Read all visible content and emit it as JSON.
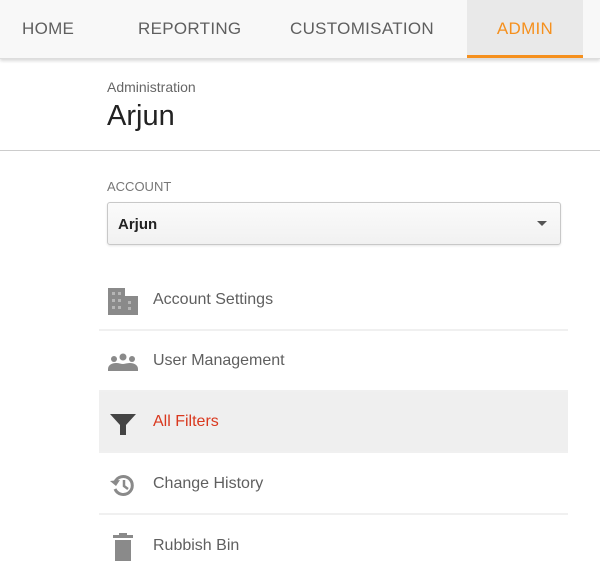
{
  "tabs": [
    {
      "label": "HOME"
    },
    {
      "label": "REPORTING"
    },
    {
      "label": "CUSTOMISATION"
    },
    {
      "label": "ADMIN",
      "active": true
    }
  ],
  "header": {
    "breadcrumb": "Administration",
    "title": "Arjun"
  },
  "account": {
    "label": "ACCOUNT",
    "selected": "Arjun"
  },
  "menu": [
    {
      "label": "Account Settings",
      "icon": "building-icon"
    },
    {
      "label": "User Management",
      "icon": "people-icon"
    },
    {
      "label": "All Filters",
      "icon": "filter-icon",
      "selected": true
    },
    {
      "label": "Change History",
      "icon": "history-icon"
    },
    {
      "label": "Rubbish Bin",
      "icon": "trash-icon"
    }
  ],
  "colors": {
    "accent": "#f5901e",
    "selected_text": "#d9381e"
  }
}
